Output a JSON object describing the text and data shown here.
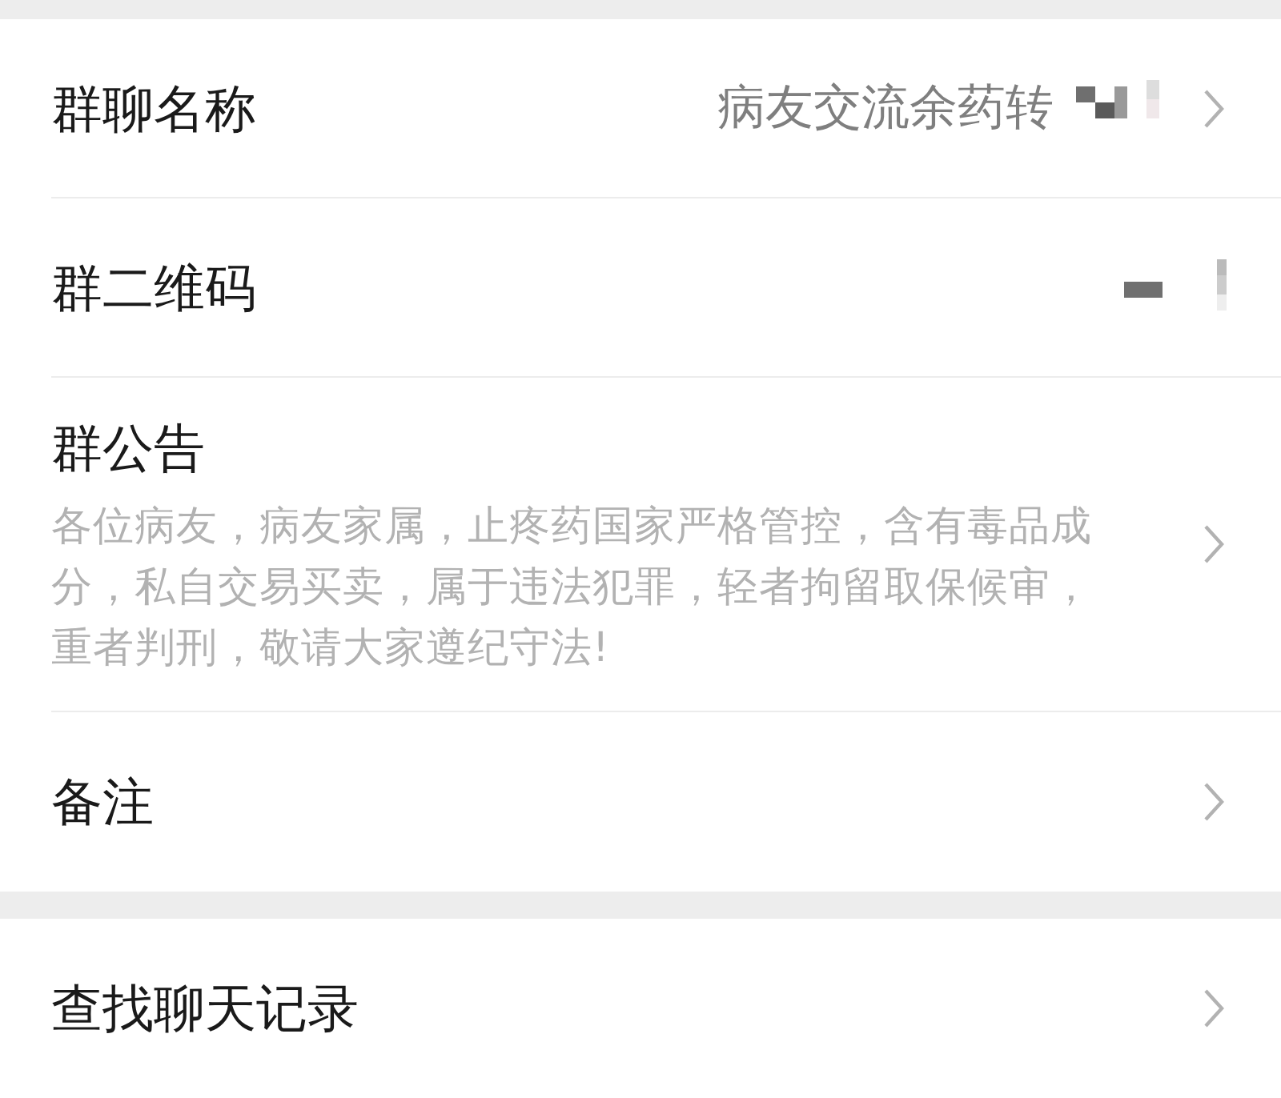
{
  "sections": [
    {
      "rows": [
        {
          "kind": "value",
          "label": "群聊名称",
          "value": "病友交流余药转",
          "chevron": true
        },
        {
          "kind": "qr",
          "label": "群二维码",
          "chevron": false
        },
        {
          "kind": "notice",
          "label": "群公告",
          "text": "各位病友，病友家属，止疼药国家严格管控，含有毒品成分，私自交易买卖，属于违法犯罪，轻者拘留取保候审，重者判刑，敬请大家遵纪守法!",
          "chevron": true
        },
        {
          "kind": "plain",
          "label": "备注",
          "chevron": true
        }
      ]
    },
    {
      "rows": [
        {
          "kind": "plain",
          "label": "查找聊天记录",
          "chevron": true
        }
      ]
    }
  ]
}
